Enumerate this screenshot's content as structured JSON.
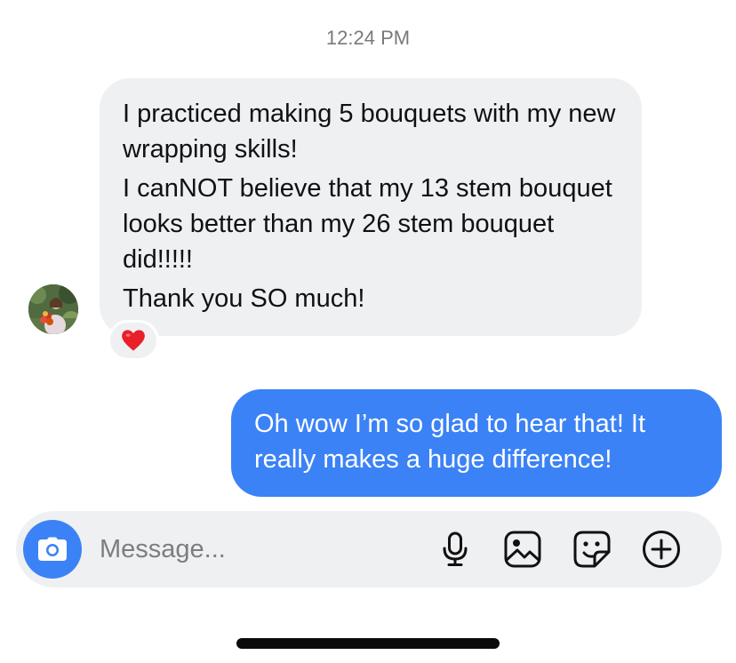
{
  "thread": {
    "timestamp": "12:24 PM"
  },
  "incoming_message": {
    "paragraphs": [
      "I practiced making 5 bouquets with my new wrapping skills!",
      "I canNOT believe that my 13 stem bouquet looks better than my 26 stem bouquet did!!!!!",
      "Thank you SO much!"
    ],
    "reaction": "heart-emoji"
  },
  "outgoing_message": {
    "text": "Oh wow I’m so glad to hear that! It really makes a huge difference!"
  },
  "composer": {
    "placeholder": "Message...",
    "value": "",
    "icons": [
      "camera-icon",
      "microphone-icon",
      "gallery-icon",
      "sticker-icon",
      "plus-icon"
    ]
  },
  "colors": {
    "accent_blue": "#3b82f6",
    "bubble_gray": "#eff0f2",
    "reaction_red": "#e8202a"
  }
}
